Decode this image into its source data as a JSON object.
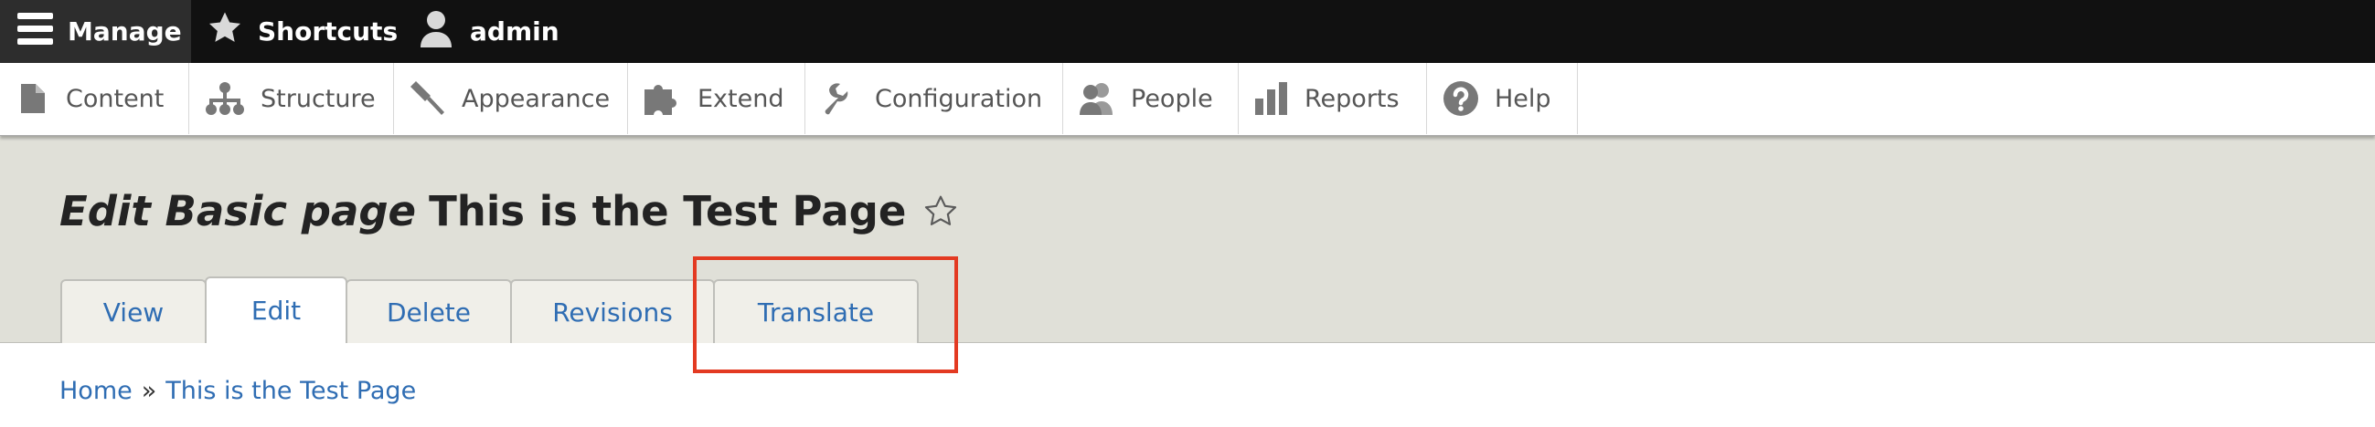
{
  "toolbar": {
    "manage_label": "Manage",
    "shortcuts_label": "Shortcuts",
    "user_label": "admin"
  },
  "tray": {
    "items": [
      {
        "label": "Content",
        "icon": "document-icon"
      },
      {
        "label": "Structure",
        "icon": "sitemap-icon"
      },
      {
        "label": "Appearance",
        "icon": "paintbrush-icon"
      },
      {
        "label": "Extend",
        "icon": "puzzle-icon"
      },
      {
        "label": "Configuration",
        "icon": "wrench-icon"
      },
      {
        "label": "People",
        "icon": "people-icon"
      },
      {
        "label": "Reports",
        "icon": "bar-chart-icon"
      },
      {
        "label": "Help",
        "icon": "question-icon"
      }
    ]
  },
  "page": {
    "title_prefix": "Edit Basic page",
    "title": "This is the Test Page"
  },
  "tabs": [
    {
      "label": "View",
      "active": false
    },
    {
      "label": "Edit",
      "active": true
    },
    {
      "label": "Delete",
      "active": false
    },
    {
      "label": "Revisions",
      "active": false
    },
    {
      "label": "Translate",
      "active": false
    }
  ],
  "breadcrumb": {
    "home": "Home",
    "separator": "»",
    "current": "This is the Test Page"
  },
  "colors": {
    "toolbar_bg": "#111111",
    "manage_bg": "#2d2d2d",
    "header_bg": "#e0e0d8",
    "link": "#2f6db3",
    "highlight": "#e33a22"
  }
}
